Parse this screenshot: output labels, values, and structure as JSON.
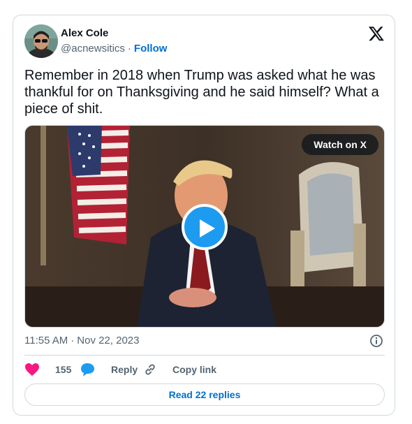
{
  "author": {
    "name": "Alex Cole",
    "handle": "@acnewsitics",
    "separator": "·",
    "follow_label": "Follow"
  },
  "tweet": {
    "text": "Remember in 2018 when Trump was asked what he was thankful for on Thanksgiving and he said himself? What a piece of shit."
  },
  "media": {
    "watch_label": "Watch on X",
    "play_icon": "play-icon"
  },
  "meta": {
    "time": "11:55 AM",
    "separator": "·",
    "date": "Nov 22, 2023"
  },
  "actions": {
    "like_count": "155",
    "reply_label": "Reply",
    "copy_label": "Copy link"
  },
  "read_replies_label": "Read 22 replies",
  "colors": {
    "link": "#006fd6",
    "play_button": "#1d9bf0",
    "heart": "#f91880",
    "reply_bubble": "#1d9bf0",
    "border": "#cfd9de",
    "muted_text": "#536471"
  },
  "icons": [
    "x-logo-icon",
    "heart-icon",
    "reply-bubble-icon",
    "link-icon",
    "info-icon",
    "play-icon"
  ]
}
